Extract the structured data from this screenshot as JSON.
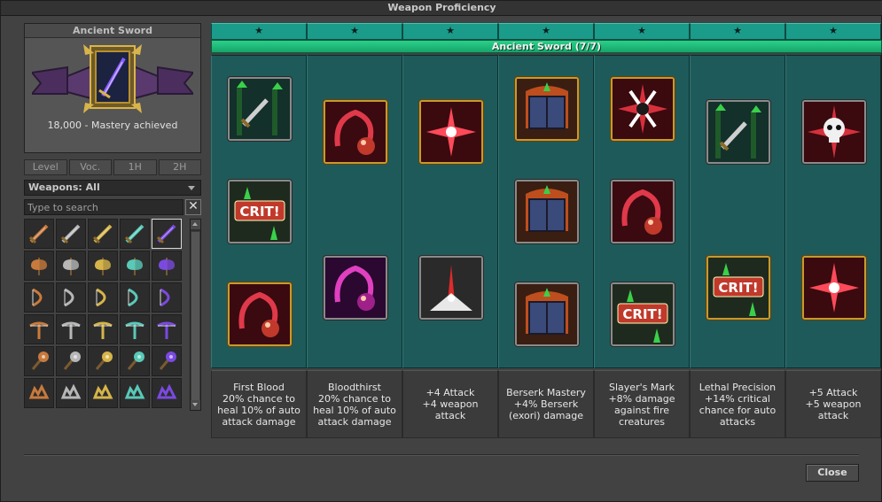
{
  "window": {
    "title": "Weapon Proficiency"
  },
  "weapon": {
    "name": "Ancient Sword",
    "mastery_text": "18,000  -  Mastery achieved"
  },
  "filter_tabs": [
    "Level",
    "Voc.",
    "1H",
    "2H"
  ],
  "weapons_select": {
    "value": "Weapons: All"
  },
  "search": {
    "placeholder": "Type to search"
  },
  "weapon_grid": {
    "rows": [
      {
        "type": "sword",
        "colors": [
          "#c87a3c",
          "#b7b7b7",
          "#d6b44a",
          "#59c9b8",
          "#7a4ae0"
        ]
      },
      {
        "type": "axe",
        "colors": [
          "#c87a3c",
          "#b7b7b7",
          "#d6b44a",
          "#59c9b8",
          "#7a4ae0"
        ]
      },
      {
        "type": "bow",
        "colors": [
          "#c87a3c",
          "#b7b7b7",
          "#d6b44a",
          "#59c9b8",
          "#7a4ae0"
        ]
      },
      {
        "type": "crossbow",
        "colors": [
          "#c87a3c",
          "#b7b7b7",
          "#d6b44a",
          "#59c9b8",
          "#7a4ae0"
        ]
      },
      {
        "type": "mace",
        "colors": [
          "#c87a3c",
          "#b7b7b7",
          "#d6b44a",
          "#59c9b8",
          "#7a4ae0"
        ]
      },
      {
        "type": "fist",
        "colors": [
          "#c87a3c",
          "#b7b7b7",
          "#d6b44a",
          "#59c9b8",
          "#7a4ae0"
        ]
      }
    ],
    "selected": [
      0,
      4
    ]
  },
  "stars": [
    "★",
    "★",
    "★",
    "★",
    "★",
    "★",
    "★"
  ],
  "track": {
    "label": "Ancient Sword  (7/7)"
  },
  "columns": [
    {
      "perks": [
        {
          "icon": "sword-attack-icon",
          "frame": "silver",
          "slot": 0
        },
        {
          "icon": "crit-icon",
          "frame": "silver",
          "slot": 1
        },
        {
          "icon": "bleed-icon",
          "frame": "gold",
          "slot": 2
        }
      ]
    },
    {
      "perks": [
        {
          "icon": "bleed-icon",
          "frame": "gold",
          "slot": 0
        },
        {
          "icon": "bleed-magenta-icon",
          "frame": "silver",
          "slot": 1
        }
      ]
    },
    {
      "perks": [
        {
          "icon": "burst-icon",
          "frame": "gold",
          "slot": 0
        },
        {
          "icon": "spike-burst-icon",
          "frame": "silver",
          "slot": 1
        }
      ]
    },
    {
      "perks": [
        {
          "icon": "berserk-book-icon",
          "frame": "gold",
          "slot": 0
        },
        {
          "icon": "berserk-book-icon",
          "frame": "silver",
          "slot": 1
        },
        {
          "icon": "berserk-book-icon",
          "frame": "silver",
          "slot": 2
        }
      ]
    },
    {
      "perks": [
        {
          "icon": "slayer-mark-icon",
          "frame": "gold",
          "slot": 0
        },
        {
          "icon": "bleed-icon",
          "frame": "silver",
          "slot": 1
        },
        {
          "icon": "crit-icon",
          "frame": "silver",
          "slot": 2
        }
      ]
    },
    {
      "perks": [
        {
          "icon": "sword-attack-icon",
          "frame": "silver",
          "slot": 0
        },
        {
          "icon": "crit-icon",
          "frame": "gold",
          "slot": 1
        }
      ]
    },
    {
      "perks": [
        {
          "icon": "skull-burst-icon",
          "frame": "silver",
          "slot": 0
        },
        {
          "icon": "burst-icon",
          "frame": "gold",
          "slot": 1
        }
      ]
    }
  ],
  "descriptions": [
    "First Blood\n20% chance to\nheal 10% of auto\nattack damage",
    "Bloodthirst\n20% chance to\nheal 10% of auto\nattack damage",
    "+4 Attack\n+4 weapon\nattack",
    "Berserk Mastery\n+4% Berserk\n(exori) damage",
    "Slayer's Mark\n+8% damage\nagainst fire\ncreatures",
    "Lethal Precision\n+14% critical\nchance for auto\nattacks",
    "+5 Attack\n+5 weapon\nattack"
  ],
  "close_button": {
    "label": "Close"
  },
  "colors": {
    "teal_bg": "#1f5a5a",
    "track_green": "#2ad08a",
    "gold_frame": "#c89a2c"
  }
}
